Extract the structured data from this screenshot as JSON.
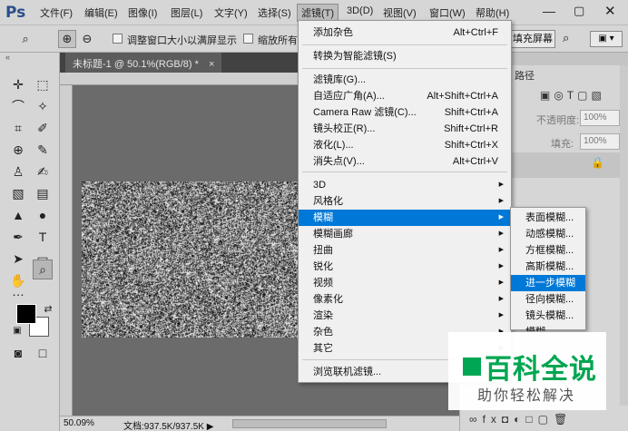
{
  "app": {
    "logo": "Ps"
  },
  "menubar": {
    "items": [
      "文件(F)",
      "编辑(E)",
      "图像(I)",
      "图层(L)",
      "文字(Y)",
      "选择(S)",
      "滤镜(T)",
      "3D(D)",
      "视图(V)",
      "窗口(W)",
      "帮助(H)"
    ],
    "active": "滤镜(T)"
  },
  "window_controls": {
    "minimize": "—",
    "maximize": "▢",
    "close": "✕"
  },
  "options_bar": {
    "resize_windows_label": "调整窗口大小以满屏显示",
    "zoom_all_label": "缩放所有",
    "fill_screen_label": "填充屏幕",
    "workspace_icon": "▣ ▾"
  },
  "document": {
    "tab_title": "未标题-1 @ 50.1%(RGB/8) *",
    "tab_close": "×",
    "zoom": "50.09%",
    "doc_info": "文档:937.5K/937.5K",
    "status_arrow": "▶"
  },
  "right_panel": {
    "tab_paths": "路径",
    "opacity_label": "不透明度:",
    "opacity_value": "100%",
    "fill_label": "填充:",
    "fill_value": "100%"
  },
  "filter_menu": {
    "items": [
      {
        "label": "添加杂色",
        "shortcut": "Alt+Ctrl+F"
      },
      {
        "label": "转换为智能滤镜(S)"
      },
      {
        "label": "滤镜库(G)..."
      },
      {
        "label": "自适应广角(A)...",
        "shortcut": "Alt+Shift+Ctrl+A"
      },
      {
        "label": "Camera Raw 滤镜(C)...",
        "shortcut": "Shift+Ctrl+A"
      },
      {
        "label": "镜头校正(R)...",
        "shortcut": "Shift+Ctrl+R"
      },
      {
        "label": "液化(L)...",
        "shortcut": "Shift+Ctrl+X"
      },
      {
        "label": "消失点(V)...",
        "shortcut": "Alt+Ctrl+V"
      },
      {
        "label": "3D"
      },
      {
        "label": "风格化"
      },
      {
        "label": "模糊"
      },
      {
        "label": "模糊画廊"
      },
      {
        "label": "扭曲"
      },
      {
        "label": "锐化"
      },
      {
        "label": "视频"
      },
      {
        "label": "像素化"
      },
      {
        "label": "渲染"
      },
      {
        "label": "杂色"
      },
      {
        "label": "其它"
      },
      {
        "label": "浏览联机滤镜..."
      }
    ],
    "highlighted": "模糊"
  },
  "blur_submenu": {
    "items": [
      "表面模糊...",
      "动感模糊...",
      "方框模糊...",
      "高斯模糊...",
      "进一步模糊",
      "径向模糊...",
      "镜头模糊...",
      "模糊"
    ],
    "highlighted": "进一步模糊"
  },
  "watermark": {
    "title": "百科全说",
    "subtitle": "助你轻松解决",
    "brand_color": "#00a651"
  },
  "colors": {
    "menu_highlight": "#0078d7",
    "foreground": "#000000",
    "background": "#ffffff"
  }
}
